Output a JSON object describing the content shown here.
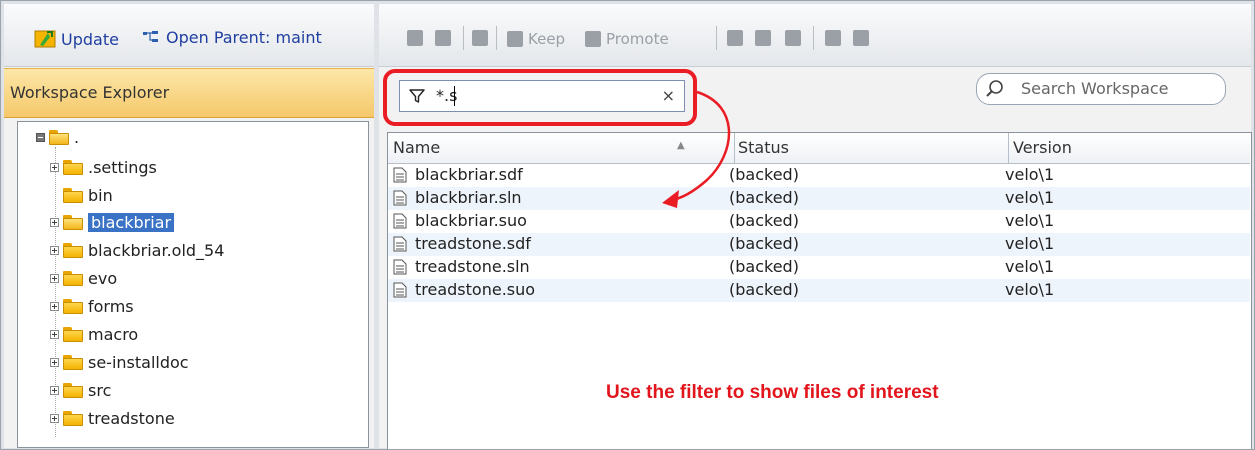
{
  "left_toolbar": {
    "update_label": "Update",
    "open_parent_label": "Open Parent: maint"
  },
  "explorer": {
    "title": "Workspace Explorer",
    "root_label": ".",
    "items": [
      {
        "label": ".settings",
        "expandable": true
      },
      {
        "label": "bin",
        "expandable": false
      },
      {
        "label": "blackbriar",
        "expandable": true,
        "selected": true
      },
      {
        "label": "blackbriar.old_54",
        "expandable": true
      },
      {
        "label": "evo",
        "expandable": true
      },
      {
        "label": "forms",
        "expandable": true
      },
      {
        "label": "macro",
        "expandable": true
      },
      {
        "label": "se-installdoc",
        "expandable": true
      },
      {
        "label": "src",
        "expandable": true
      },
      {
        "label": "treadstone",
        "expandable": true
      }
    ]
  },
  "right_toolbar": {
    "keep_label": "Keep",
    "promote_label": "Promote"
  },
  "filter": {
    "value": "*.s",
    "clear_glyph": "×"
  },
  "search": {
    "placeholder": "Search Workspace"
  },
  "grid": {
    "columns": [
      "Name",
      "Status",
      "Version"
    ],
    "rows": [
      {
        "name": "blackbriar.sdf",
        "status": "(backed)",
        "version": "velo\\1"
      },
      {
        "name": "blackbriar.sln",
        "status": "(backed)",
        "version": "velo\\1"
      },
      {
        "name": "blackbriar.suo",
        "status": "(backed)",
        "version": "velo\\1"
      },
      {
        "name": "treadstone.sdf",
        "status": "(backed)",
        "version": "velo\\1"
      },
      {
        "name": "treadstone.sln",
        "status": "(backed)",
        "version": "velo\\1"
      },
      {
        "name": "treadstone.suo",
        "status": "(backed)",
        "version": "velo\\1"
      }
    ]
  },
  "annotation": "Use the filter to show files of interest",
  "colors": {
    "highlight_red": "#ea1c24",
    "selection_blue": "#3a73c6",
    "explorer_header": "#f5c86a"
  }
}
